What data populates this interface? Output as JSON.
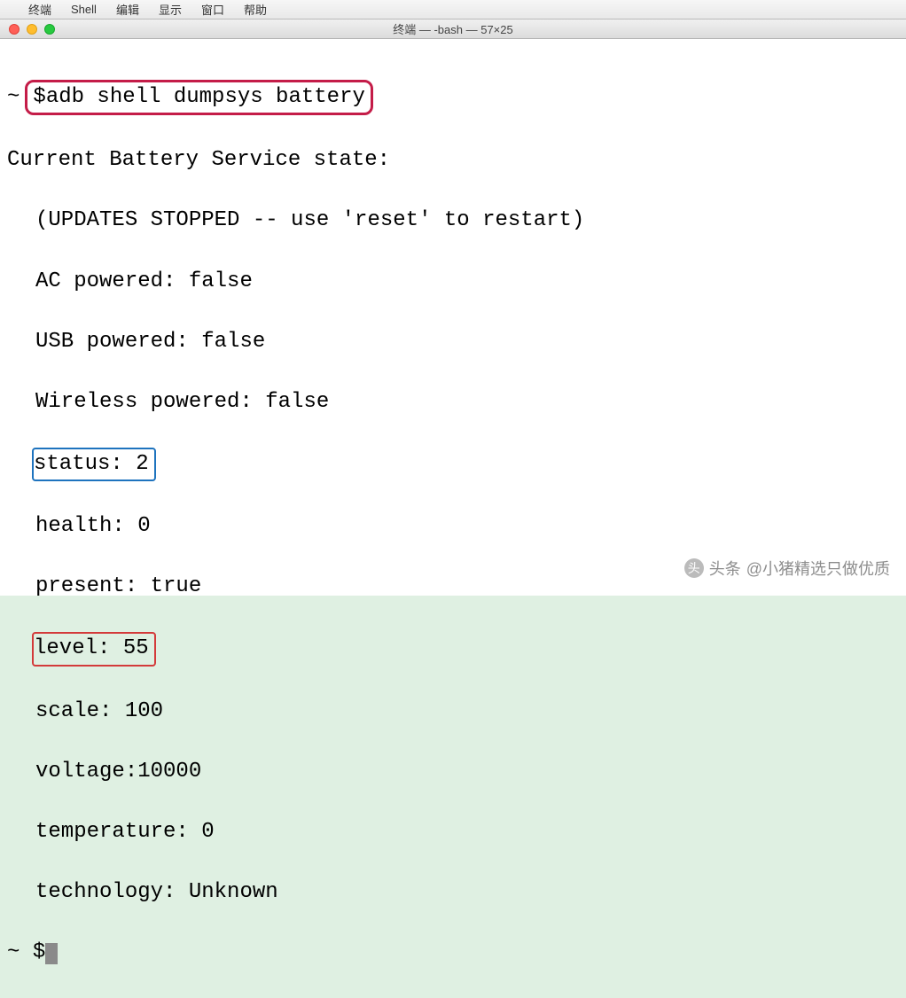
{
  "menubar": {
    "apple": "",
    "items": [
      "终端",
      "Shell",
      "编辑",
      "显示",
      "窗口",
      "帮助"
    ]
  },
  "window": {
    "title": "终端 — -bash — 57×25"
  },
  "terminal": {
    "prompt": "~",
    "dollar": "$",
    "command": "adb shell dumpsys battery",
    "output": {
      "header": "Current Battery Service state:",
      "note": "(UPDATES STOPPED -- use 'reset' to restart)",
      "ac": "AC powered: false",
      "usb": "USB powered: false",
      "wireless": "Wireless powered: false",
      "status": "status: 2",
      "health": "health: 0",
      "present": "present: true",
      "level": "level: 55",
      "scale": "scale: 100",
      "voltage": "voltage:10000",
      "temperature": "temperature: 0",
      "technology": "technology: Unknown"
    }
  },
  "watermark": {
    "label": "头条",
    "handle": "@小猪精选只做优质"
  }
}
